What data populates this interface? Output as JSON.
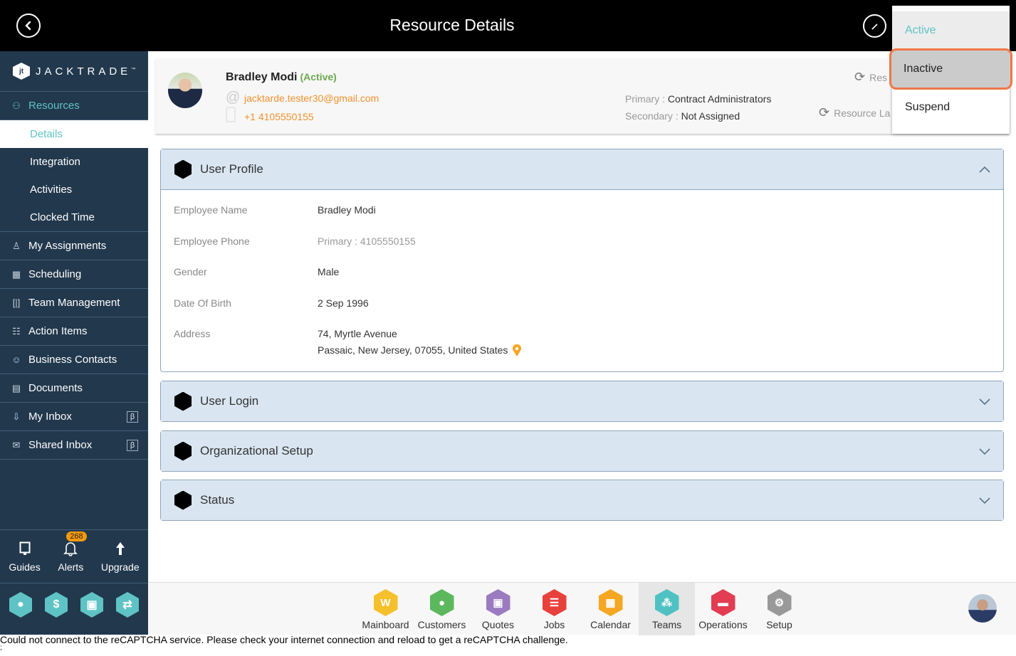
{
  "topbar": {
    "title": "Resource Details",
    "back_icon": "back-circle-icon",
    "edit_icon": "pencil-icon"
  },
  "brand": {
    "name": "JACKTRADE",
    "tm": "™"
  },
  "sidebar": {
    "resources": {
      "label": "Resources",
      "icon": "resources-icon"
    },
    "sub_items": [
      {
        "label": "Details",
        "selected": true
      },
      {
        "label": "Integration"
      },
      {
        "label": "Activities"
      },
      {
        "label": "Clocked Time"
      }
    ],
    "items": [
      {
        "label": "My Assignments",
        "icon": "assignments-icon"
      },
      {
        "label": "Scheduling",
        "icon": "calendar-clock-icon"
      },
      {
        "label": "Team Management",
        "icon": "team-bracket-icon"
      },
      {
        "label": "Action Items",
        "icon": "clipboard-icon"
      },
      {
        "label": "Business Contacts",
        "icon": "contact-book-icon"
      },
      {
        "label": "Documents",
        "icon": "document-icon"
      },
      {
        "label": "My Inbox",
        "icon": "inbox-icon",
        "badge": "β"
      },
      {
        "label": "Shared Inbox",
        "icon": "envelope-icon",
        "badge": "β"
      }
    ],
    "tools": [
      {
        "label": "Guides",
        "icon": "book-icon"
      },
      {
        "label": "Alerts",
        "icon": "bell-icon",
        "badge": "268"
      },
      {
        "label": "Upgrade",
        "icon": "arrow-up-icon"
      }
    ],
    "quick_icons": [
      "user-icon",
      "dollar-icon",
      "money-icon",
      "workflow-icon"
    ]
  },
  "profile": {
    "name": "Bradley Modi",
    "status": "(Active)",
    "email": "jacktarde.tester30@gmail.com",
    "phone": "+1 4105550155",
    "primary_label": "Primary : ",
    "primary_value": "Contract Administrators",
    "secondary_label": "Secondary : ",
    "secondary_value": "Not Assigned",
    "link1": "Res",
    "link2": "Resource La"
  },
  "status_dropdown": {
    "options": [
      "Active",
      "Inactive",
      "Suspend"
    ],
    "current": "Active",
    "hovered": "Inactive"
  },
  "sections": [
    {
      "title": "User Profile",
      "expanded": true,
      "rows": [
        {
          "label": "Employee Name",
          "value": "Bradley Modi"
        },
        {
          "label": "Employee Phone",
          "value": "Primary :  4105550155"
        },
        {
          "label": "Gender",
          "value": "Male"
        },
        {
          "label": "Date Of Birth",
          "value": "2 Sep 1996"
        },
        {
          "label": "Address",
          "value": "74, Myrtle Avenue",
          "value2": "Passaic, New Jersey, 07055, United States"
        }
      ]
    },
    {
      "title": "User Login",
      "expanded": false
    },
    {
      "title": "Organizational Setup",
      "expanded": false
    },
    {
      "title": "Status",
      "expanded": false
    }
  ],
  "apps": [
    {
      "label": "Mainboard",
      "color": "#f5c02c"
    },
    {
      "label": "Customers",
      "color": "#5cb85c"
    },
    {
      "label": "Quotes",
      "color": "#9b7bbf"
    },
    {
      "label": "Jobs",
      "color": "#e8413c"
    },
    {
      "label": "Calendar",
      "color": "#f5a623"
    },
    {
      "label": "Teams",
      "color": "#4fc1c3",
      "selected": true
    },
    {
      "label": "Operations",
      "color": "#e23d52"
    },
    {
      "label": "Setup",
      "color": "#999999"
    }
  ],
  "captcha_message": "Could not connect to the reCAPTCHA service. Please check your internet connection and reload to get a reCAPTCHA challenge.",
  "captcha_extra": ";"
}
